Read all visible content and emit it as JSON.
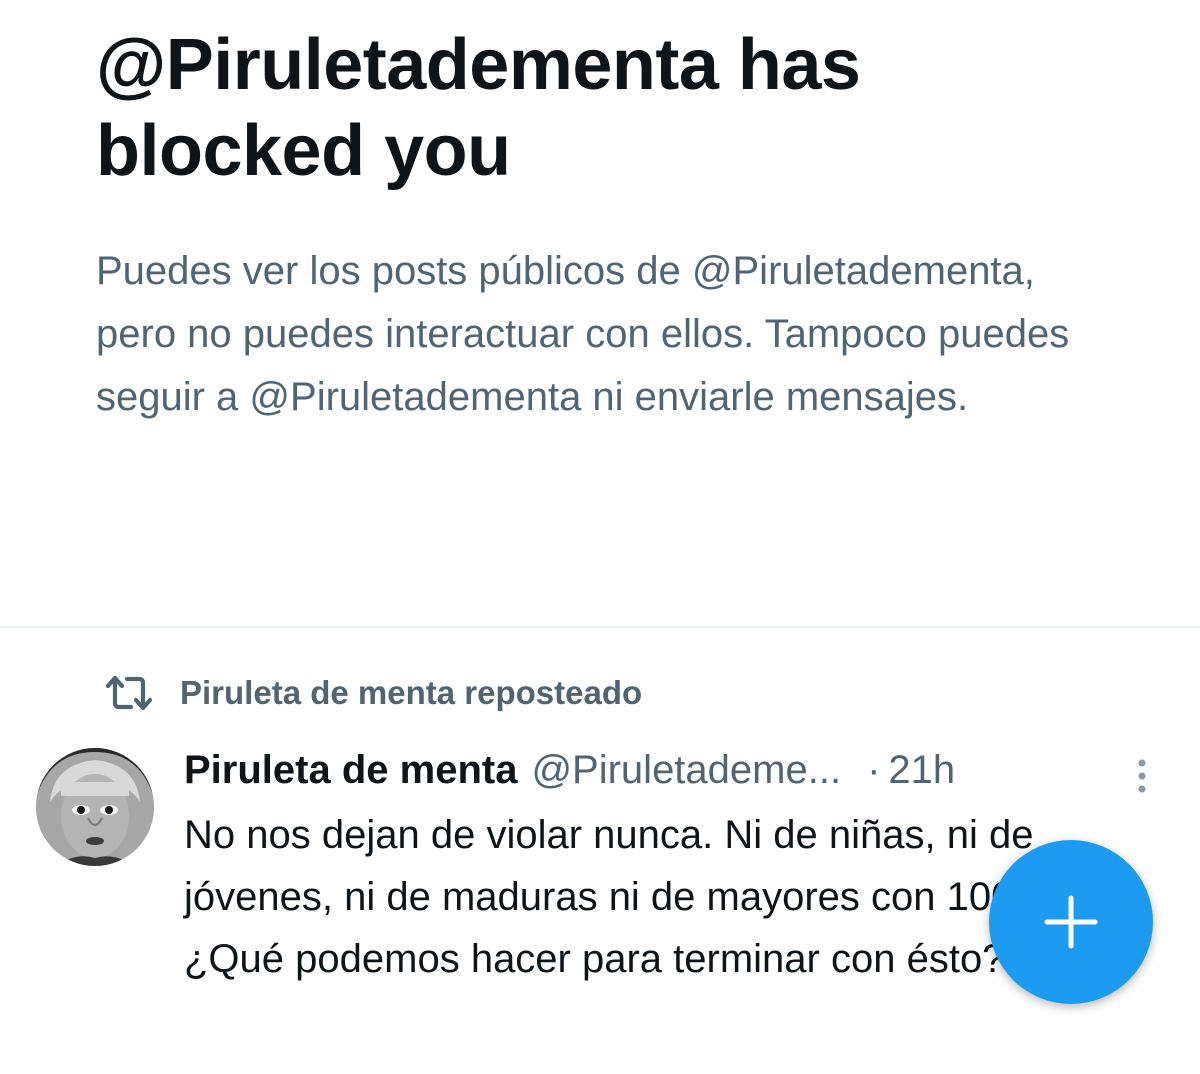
{
  "blocked": {
    "title": "@Piruletadementa has blocked you",
    "description": "Puedes ver los posts públicos de @Piruletadementa, pero no puedes interactuar con ellos. Tampoco puedes seguir a @Piruletadementa ni enviarle mensajes."
  },
  "repost": {
    "icon": "repost-icon",
    "label": "Piruleta de menta reposteado"
  },
  "post": {
    "author_name": "Piruleta de menta",
    "author_handle": "@Piruletademe...",
    "separator": "·",
    "time": "21h",
    "more_icon": "more-vertical-icon",
    "text": "No nos dejan de violar nunca. Ni de niñas, ni de jóvenes, ni de maduras ni de mayores con 100 años. ¿Qué podemos hacer para terminar con ésto?"
  },
  "fab": {
    "icon": "plus-icon"
  },
  "colors": {
    "text_primary": "#0f1419",
    "text_secondary": "#536471",
    "accent": "#1d9bf0",
    "divider": "#eff3f4"
  }
}
